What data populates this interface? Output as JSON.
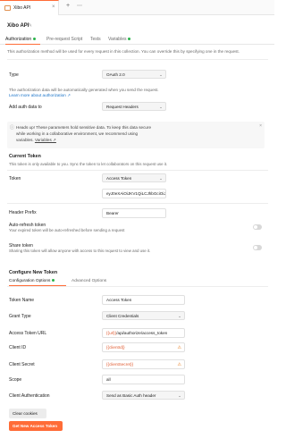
{
  "tab": {
    "title": "Xibo API",
    "close": "×",
    "plus": "+",
    "more": "⋯"
  },
  "request": {
    "name": "Xibo API"
  },
  "subtabs": [
    {
      "label": "Authorization",
      "active": true,
      "dot": "#29b34a"
    },
    {
      "label": "Pre-request Script"
    },
    {
      "label": "Tests"
    },
    {
      "label": "Variables",
      "dot": "#29b34a"
    }
  ],
  "note": "This authorization method will be used for every request in this collection. You can override this by specifying one in the request.",
  "type": {
    "label": "Type",
    "value": "OAuth 2.0"
  },
  "auth_desc": {
    "line1": "The authorization data will be automatically generated when you send the request.",
    "link": "Learn more about authorization ↗"
  },
  "add_auth": {
    "label": "Add auth data to",
    "value": "Request Headers"
  },
  "heads_up": {
    "line1": "Heads up! These parameters hold sensitive data. To keep this data secure",
    "line2": "while working in a collaborative environment, we recommend using",
    "line3": "variables.",
    "link": "Variables ↗"
  },
  "current_token": {
    "title": "Current Token",
    "desc": "This token is only available to you. Sync the token to let collaborators on this request use it.",
    "token_label": "Token",
    "token_select": "Access Token",
    "token_value": "eyJ0eXAiOiJKV1QiLCJhbGciOiJSUzI",
    "header_prefix_label": "Header Prefix",
    "header_prefix_value": "Bearer",
    "auto_refresh_label": "Auto-refresh token",
    "auto_refresh_desc": "Your expired token will be auto-refreshed before sending a request",
    "share_label": "Share token",
    "share_desc": "Sharing this token will allow anyone with access to this request to view and use it."
  },
  "configure": {
    "title": "Configure New Token",
    "tabs": [
      "Configuration Options",
      "Advanced Options"
    ],
    "rows": [
      {
        "label": "Token Name",
        "value": "Access Token",
        "kind": "input"
      },
      {
        "label": "Grant Type",
        "value": "Client Credentials",
        "kind": "select"
      },
      {
        "label": "Access Token URL",
        "value_var": "{{url}}",
        "value_rest": "/api/authorize/access_token",
        "kind": "input"
      },
      {
        "label": "Client ID",
        "value": "{{clientId}}",
        "kind": "input-var"
      },
      {
        "label": "Client Secret",
        "value": "{{clientSecret}}",
        "kind": "input-var"
      },
      {
        "label": "Scope",
        "value": "all",
        "kind": "input"
      },
      {
        "label": "Client Authentication",
        "value": "Send as Basic Auth header",
        "kind": "select"
      }
    ]
  },
  "buttons": {
    "clear": "Clear cookies",
    "get": "Get New Access Token"
  },
  "icons": {
    "pencil": "✎",
    "caret": "⌄",
    "info": "ⓘ",
    "warn": "⚠"
  },
  "colors": {
    "accent": "#ff6c37",
    "success": "#29b34a",
    "variable": "#e05a2f"
  }
}
